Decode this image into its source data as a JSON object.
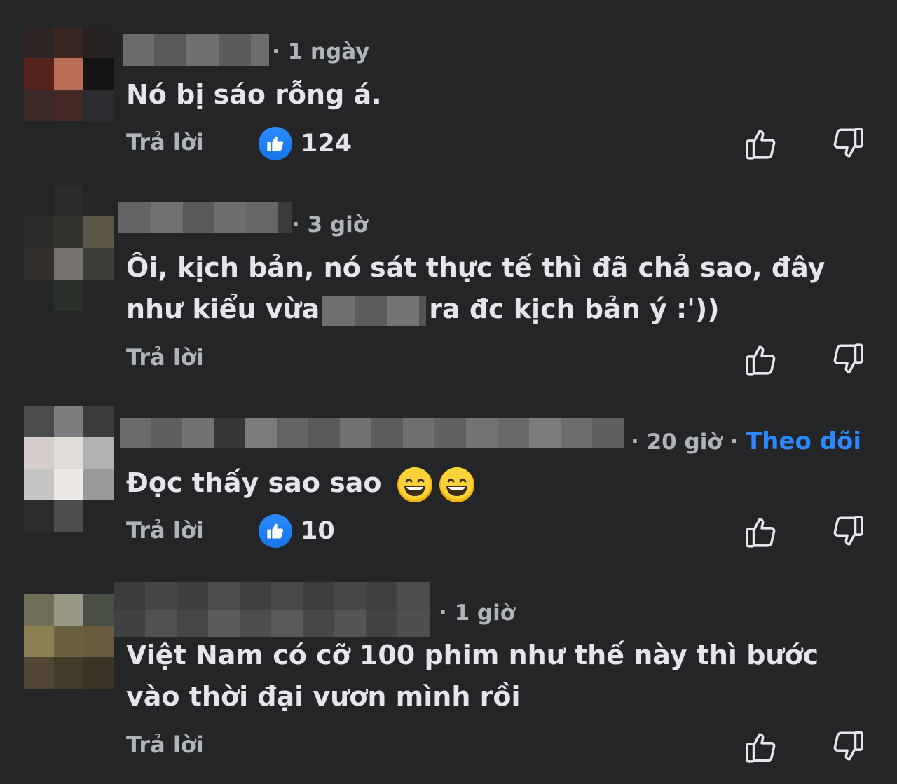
{
  "comments": [
    {
      "time": "· 1 ngày",
      "text": "Nó bị sáo rỗng á.",
      "reply_label": "Trả lời",
      "reaction_count": "124"
    },
    {
      "time": "· 3 giờ",
      "text_line1": "Ôi, kịch bản, nó sát thực tế thì đã chả sao, đây",
      "text_line2_start": "như kiểu vừa",
      "text_line2_end": "ra đc kịch bản ý :'))",
      "reply_label": "Trả lời"
    },
    {
      "time": "· 20 giờ ·",
      "follow_label": "Theo dõi",
      "text": "Đọc thấy sao sao",
      "reply_label": "Trả lời",
      "reaction_count": "10"
    },
    {
      "time": "· 1 giờ",
      "text_line1": "Việt Nam có cỡ 100 phim như thế này thì bước",
      "text_line2": "vào thời đại vươn mình rồi",
      "reply_label": "Trả lời"
    }
  ],
  "icons": {
    "like_badge": "like-icon",
    "upvote": "thumbs-up-icon",
    "downvote": "thumbs-down-icon",
    "emoji": "grinning-face-icon"
  },
  "colors": {
    "background": "#242526",
    "text": "#e4e6eb",
    "secondary": "#b0b3b8",
    "accent": "#2d88ff"
  }
}
